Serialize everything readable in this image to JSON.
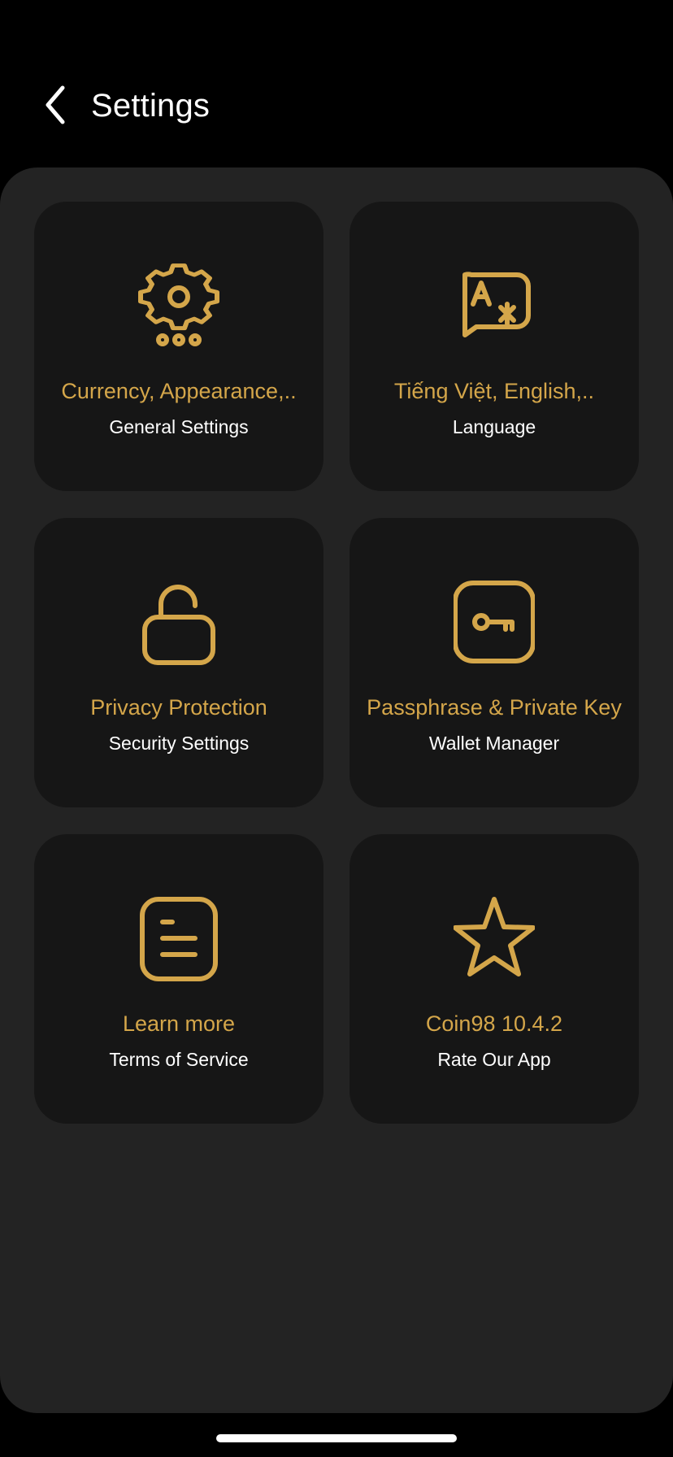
{
  "header": {
    "title": "Settings",
    "back_icon": "chevron-left-icon"
  },
  "colors": {
    "accent": "#d4a64a",
    "background": "#000000",
    "panel": "#232323",
    "card": "#161616",
    "text_primary": "#ffffff"
  },
  "cards": [
    {
      "title": "Currency, Appearance,..",
      "subtitle": "General Settings",
      "icon": "gear-icon"
    },
    {
      "title": "Tiếng Việt, English,..",
      "subtitle": "Language",
      "icon": "translate-icon"
    },
    {
      "title": "Privacy Protection",
      "subtitle": "Security Settings",
      "icon": "unlock-icon"
    },
    {
      "title": "Passphrase & Private Key",
      "subtitle": "Wallet Manager",
      "icon": "key-icon"
    },
    {
      "title": "Learn more",
      "subtitle": "Terms of Service",
      "icon": "document-icon"
    },
    {
      "title": "Coin98 10.4.2",
      "subtitle": "Rate Our App",
      "icon": "star-icon"
    }
  ]
}
